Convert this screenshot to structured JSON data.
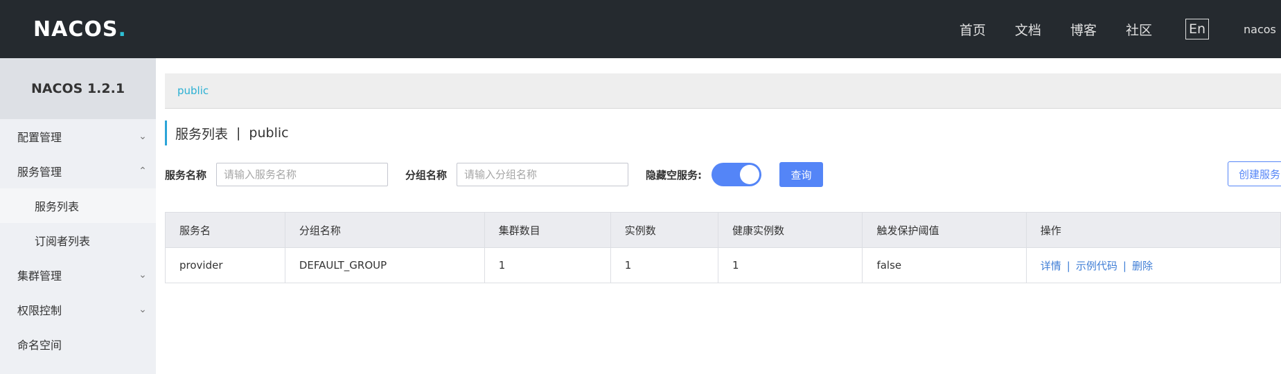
{
  "header": {
    "logo": "NACOS",
    "logo_dot": ".",
    "nav": [
      "首页",
      "文档",
      "博客",
      "社区"
    ],
    "lang": "En",
    "user": "nacos"
  },
  "sidebar": {
    "title": "NACOS 1.2.1",
    "items": [
      {
        "label": "配置管理",
        "chevron": "down"
      },
      {
        "label": "服务管理",
        "chevron": "up"
      },
      {
        "label": "服务列表"
      },
      {
        "label": "订阅者列表"
      },
      {
        "label": "集群管理",
        "chevron": "down"
      },
      {
        "label": "权限控制",
        "chevron": "down"
      },
      {
        "label": "命名空间"
      }
    ]
  },
  "breadcrumb": "public",
  "page": {
    "title": "服务列表",
    "separator": "|",
    "namespace": "public"
  },
  "filters": {
    "service_label": "服务名称",
    "service_placeholder": "请输入服务名称",
    "group_label": "分组名称",
    "group_placeholder": "请输入分组名称",
    "hide_empty_label": "隐藏空服务:",
    "hide_empty_on": true,
    "query_button": "查询",
    "create_button": "创建服务"
  },
  "table": {
    "headers": [
      "服务名",
      "分组名称",
      "集群数目",
      "实例数",
      "健康实例数",
      "触发保护阈值",
      "操作"
    ],
    "rows": [
      {
        "cells": [
          "provider",
          "DEFAULT_GROUP",
          "1",
          "1",
          "1",
          "false"
        ],
        "ops": [
          "详情",
          "示例代码",
          "删除"
        ],
        "op_sep": "|"
      }
    ]
  },
  "colors": {
    "topbar": "#252a2f",
    "accent": "#5485f7",
    "link": "#3f7ed6",
    "breadcrumb": "#2bb0d3"
  }
}
